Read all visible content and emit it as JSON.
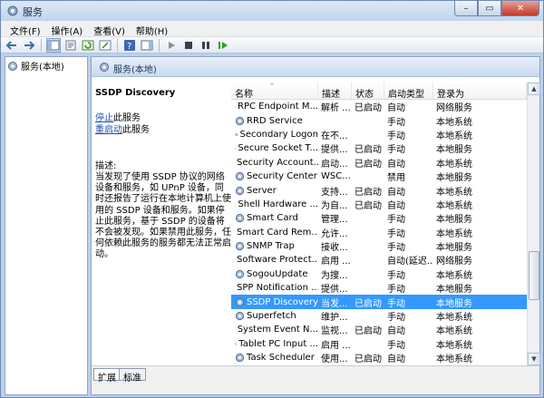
{
  "window": {
    "title": "服务"
  },
  "menu": [
    "文件(F)",
    "操作(A)",
    "查看(V)",
    "帮助(H)"
  ],
  "window_buttons": {
    "minimize": "–",
    "maximize": "▭",
    "close": "✕"
  },
  "tree": {
    "root": "服务(本地)"
  },
  "right_header": {
    "title": "服务(本地)"
  },
  "description": {
    "service_title": "SSDP Discovery",
    "stop_link": "停止",
    "stop_suffix": "此服务",
    "restart_link": "重启动",
    "restart_suffix": "此服务",
    "label": "描述:",
    "body": "当发现了使用 SSDP 协议的网络设备和服务，如 UPnP 设备，同时还报告了运行在本地计算机上使用的 SSDP 设备和服务。如果停止此服务，基于 SSDP 的设备将不会被发现。如果禁用此服务，任何依赖此服务的服务都无法正常启动。"
  },
  "table": {
    "columns": [
      "名称",
      "描述",
      "状态",
      "启动类型",
      "登录为"
    ],
    "sort_indicator": "^",
    "selected_row": 14,
    "rows": [
      {
        "name": "RPC Endpoint M...",
        "desc": "解析 ...",
        "status": "已启动",
        "start": "自动",
        "logon": "网络服务"
      },
      {
        "name": "RRD Service",
        "desc": "",
        "status": "",
        "start": "手动",
        "logon": "本地系统"
      },
      {
        "name": "Secondary Logon",
        "desc": "在不...",
        "status": "",
        "start": "手动",
        "logon": "本地系统"
      },
      {
        "name": "Secure Socket T...",
        "desc": "提供...",
        "status": "已启动",
        "start": "手动",
        "logon": "本地服务"
      },
      {
        "name": "Security Account...",
        "desc": "启动...",
        "status": "已启动",
        "start": "自动",
        "logon": "本地系统"
      },
      {
        "name": "Security Center",
        "desc": "WSC...",
        "status": "",
        "start": "禁用",
        "logon": "本地服务"
      },
      {
        "name": "Server",
        "desc": "支持...",
        "status": "已启动",
        "start": "自动",
        "logon": "本地系统"
      },
      {
        "name": "Shell Hardware ...",
        "desc": "为自...",
        "status": "已启动",
        "start": "自动",
        "logon": "本地系统"
      },
      {
        "name": "Smart Card",
        "desc": "管理...",
        "status": "",
        "start": "手动",
        "logon": "本地服务"
      },
      {
        "name": "Smart Card Rem...",
        "desc": "允许...",
        "status": "",
        "start": "手动",
        "logon": "本地系统"
      },
      {
        "name": "SNMP Trap",
        "desc": "接收...",
        "status": "",
        "start": "手动",
        "logon": "本地服务"
      },
      {
        "name": "Software Protect...",
        "desc": "启用 ...",
        "status": "",
        "start": "自动(延迟...",
        "logon": "网络服务"
      },
      {
        "name": "SogouUpdate",
        "desc": "为搜...",
        "status": "",
        "start": "手动",
        "logon": "本地系统"
      },
      {
        "name": "SPP Notification ...",
        "desc": "提供...",
        "status": "",
        "start": "手动",
        "logon": "本地服务"
      },
      {
        "name": "SSDP Discovery",
        "desc": "当发...",
        "status": "已启动",
        "start": "手动",
        "logon": "本地服务"
      },
      {
        "name": "Superfetch",
        "desc": "维护...",
        "status": "",
        "start": "手动",
        "logon": "本地系统"
      },
      {
        "name": "System Event N...",
        "desc": "监视...",
        "status": "已启动",
        "start": "自动",
        "logon": "本地系统"
      },
      {
        "name": "Tablet PC Input ...",
        "desc": "启用 ...",
        "status": "",
        "start": "手动",
        "logon": "本地系统"
      },
      {
        "name": "Task Scheduler",
        "desc": "使用...",
        "status": "已启动",
        "start": "自动",
        "logon": "本地系统"
      }
    ]
  },
  "scrollbar": {
    "up": "▲",
    "down": "▼"
  },
  "tabs": [
    "扩展",
    "标准"
  ],
  "colors": {
    "selection": "#3399ff",
    "link": "#1f4fb3",
    "frame": "#bcd0e8"
  }
}
